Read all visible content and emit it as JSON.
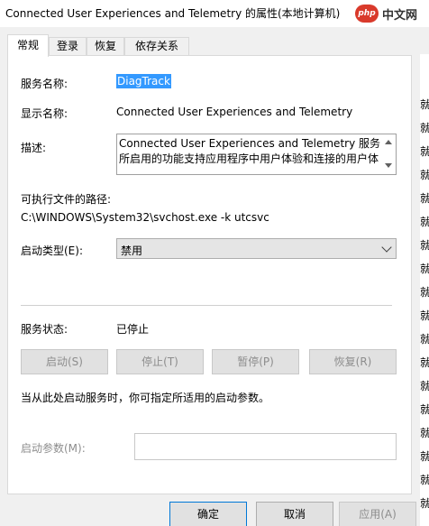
{
  "window": {
    "title": "Connected User Experiences and Telemetry 的属性(本地计算机)",
    "watermark": {
      "badge": "php",
      "text": "中文网"
    }
  },
  "tabs": [
    {
      "label": "常规",
      "active": true
    },
    {
      "label": "登录",
      "active": false
    },
    {
      "label": "恢复",
      "active": false
    },
    {
      "label": "依存关系",
      "active": false
    }
  ],
  "general": {
    "service_name_label": "服务名称:",
    "service_name_value": "DiagTrack",
    "display_name_label": "显示名称:",
    "display_name_value": "Connected User Experiences and Telemetry",
    "description_label": "描述:",
    "description_value": "Connected User Experiences and Telemetry 服务所启用的功能支持应用程序中用户体验和连接的用户体",
    "exe_path_label": "可执行文件的路径:",
    "exe_path_value": "C:\\WINDOWS\\System32\\svchost.exe -k utcsvc",
    "startup_type_label": "启动类型(E):",
    "startup_type_value": "禁用",
    "service_status_label": "服务状态:",
    "service_status_value": "已停止",
    "buttons": {
      "start": "启动(S)",
      "stop": "停止(T)",
      "pause": "暂停(P)",
      "resume": "恢复(R)"
    },
    "hint": "当从此处启动服务时，你可指定所适用的启动参数。",
    "start_params_label": "启动参数(M):",
    "start_params_value": ""
  },
  "dialog_buttons": {
    "ok": "确定",
    "cancel": "取消",
    "apply": "应用(A)"
  },
  "background_glyph": "就",
  "colors": {
    "selection": "#3399ff",
    "default_button_border": "#0078d7",
    "watermark_badge": "#d93a2b"
  }
}
